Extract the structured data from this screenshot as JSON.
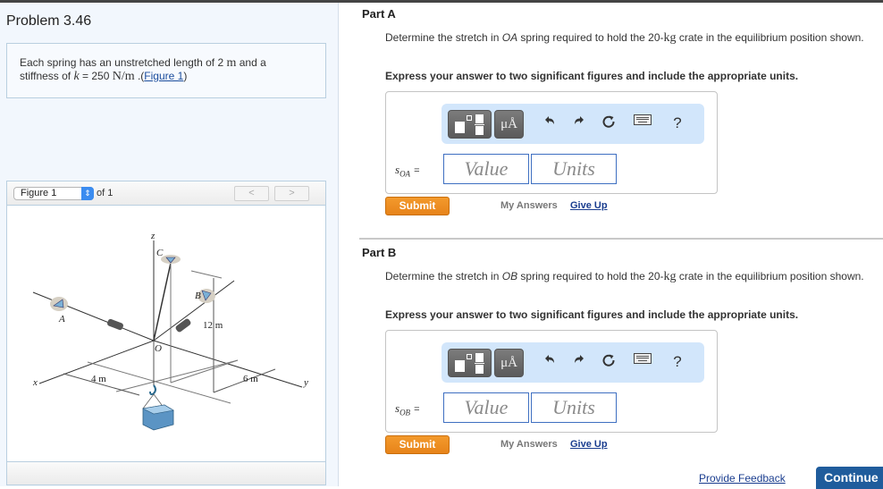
{
  "problem": {
    "title": "Problem 3.46",
    "statement": {
      "line1_pre": "Each spring has an unstretched length of 2 ",
      "line1_unit": "m",
      "line1_post": " and a",
      "line2_pre": "stiffness of ",
      "line2_k": "k",
      "line2_mid": " = 250 ",
      "line2_unit": "N/m",
      "line2_dot": " .(",
      "figure_link": "Figure 1",
      "line2_close": ")"
    }
  },
  "figure_panel": {
    "select_value": "Figure 1",
    "of_label": "of 1",
    "prev_icon": "chevron-left-icon",
    "next_icon": "chevron-right-icon",
    "labels": {
      "z": "z",
      "C": "C",
      "B": "B",
      "A": "A",
      "O": "O",
      "x": "x",
      "y": "y",
      "dim_12": "12 m",
      "dim_4": "4 m",
      "dim_6": "6 m"
    }
  },
  "parts": [
    {
      "title": "Part A",
      "desc_pre": "Determine the stretch in ",
      "desc_spring": "OA",
      "desc_mid": " spring required to hold the 20-",
      "desc_unit": "kg",
      "desc_post": " crate in the equilibrium position shown.",
      "instruction": "Express your answer to two significant figures and include the appropriate units.",
      "answer_symbol": "s",
      "answer_sub": "OA",
      "equals": "=",
      "value_placeholder": "Value",
      "units_placeholder": "Units",
      "submit": "Submit",
      "my_answers": "My Answers",
      "give_up": "Give Up"
    },
    {
      "title": "Part B",
      "desc_pre": "Determine the stretch in ",
      "desc_spring": "OB",
      "desc_mid": " spring required to hold the 20-",
      "desc_unit": "kg",
      "desc_post": " crate in the equilibrium position shown.",
      "instruction": "Express your answer to two significant figures and include the appropriate units.",
      "answer_symbol": "s",
      "answer_sub": "OB",
      "equals": "=",
      "value_placeholder": "Value",
      "units_placeholder": "Units",
      "submit": "Submit",
      "my_answers": "My Answers",
      "give_up": "Give Up"
    }
  ],
  "toolbar": {
    "units_label": "μÅ",
    "help_label": "?",
    "icons": [
      "templates-icon",
      "units-icon",
      "undo-icon",
      "redo-icon",
      "reset-icon",
      "keyboard-icon",
      "help-icon"
    ]
  },
  "footer": {
    "feedback": "Provide Feedback",
    "continue": "Continue"
  },
  "colors": {
    "accent_blue": "#1f5c9c",
    "submit_orange": "#f0901f",
    "toolbar_bg": "#d2e6fb",
    "link": "#1a3d8f"
  }
}
